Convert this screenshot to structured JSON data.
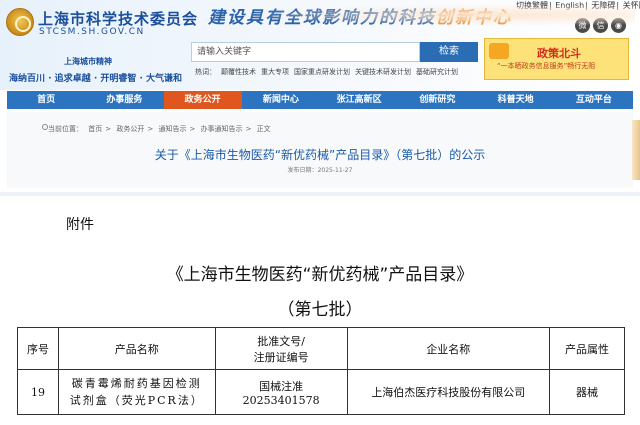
{
  "header": {
    "org_name": "上海市科学技术委员会",
    "domain": "STCSM.SH.GOV.CN",
    "slogan_main": "建设具有全球影响力的科技",
    "slogan_tail": "创新中心",
    "spirit_title": "上海城市精神",
    "spirit_text": "海纳百川 · 追求卓越 · 开明睿智 · 大气谦和",
    "top_links": [
      "切换繁體",
      "English",
      "无障碍",
      "关怀版"
    ],
    "social_icons": [
      "weibo-icon",
      "wechat-icon",
      "app-icon"
    ]
  },
  "search": {
    "placeholder": "请输入关键字",
    "button": "检索",
    "hot_label": "热词：",
    "hot_terms": [
      "颠覆性技术",
      "重大专项",
      "国家重点研发计划",
      "关键技术研发计划",
      "基础研究计划"
    ]
  },
  "promo": {
    "title": "政策北斗",
    "subtitle": "“一本晒政务信息服务”畅行无阻"
  },
  "nav": {
    "items": [
      "首页",
      "办事服务",
      "政务公开",
      "新闻中心",
      "张江高新区",
      "创新研究",
      "科普天地",
      "互动平台"
    ],
    "active_index": 2
  },
  "breadcrumb": {
    "label": "当前位置：",
    "items": [
      "首页",
      "政务公开",
      "通知告示",
      "办事通知告示",
      "正文"
    ],
    "separator": ">"
  },
  "notice": {
    "title": "关于《上海市生物医药“新优药械”产品目录》（第七批）的公示",
    "date_label": "发布日期：",
    "date": "2025-11-27"
  },
  "document": {
    "attachment_label": "附件",
    "title": "《上海市生物医药“新优药械”产品目录》",
    "batch": "（第七批）",
    "table": {
      "headers": [
        "序号",
        "产品名称",
        "批准文号/注册证编号",
        "企业名称",
        "产品属性"
      ],
      "header_approval_line1": "批准文号/",
      "header_approval_line2": "注册证编号",
      "rows": [
        {
          "no": "19",
          "name_line1": "碳青霉烯耐药基因检测",
          "name_line2": "试剂盒（荧光PCR法）",
          "approval_line1": "国械注准",
          "approval_line2": "20253401578",
          "company": "上海伯杰医疗科技股份有限公司",
          "attribute": "器械"
        }
      ]
    }
  },
  "colors": {
    "brand_blue": "#1b4f9c",
    "nav_blue": "#2c73c0",
    "nav_active": "#e0561f",
    "title_blue": "#1b5aa8"
  }
}
